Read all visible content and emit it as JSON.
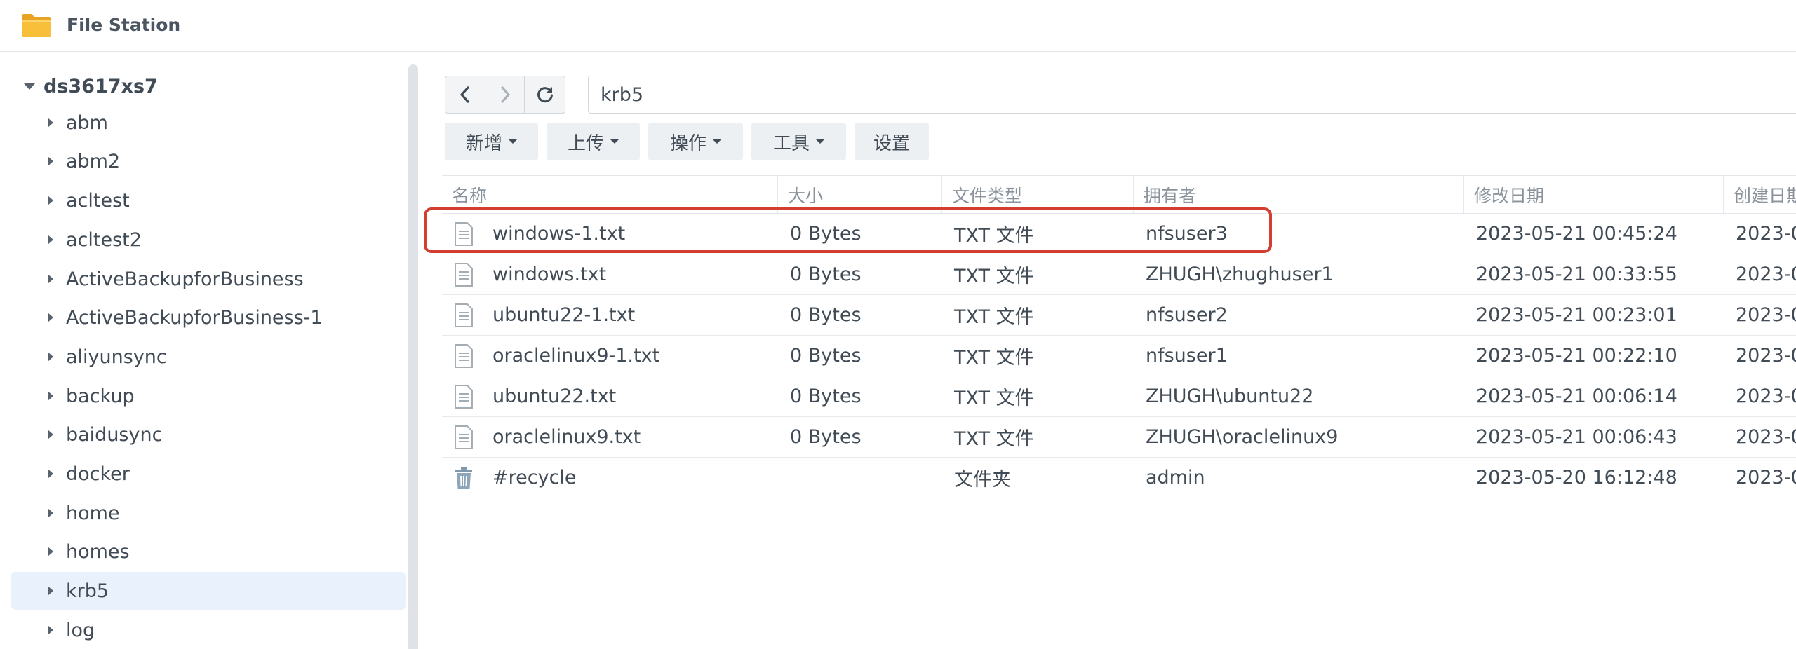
{
  "app": {
    "title": "File Station",
    "icon": "folder-icon"
  },
  "sidebar": {
    "root": "ds3617xs7",
    "items": [
      {
        "label": "abm"
      },
      {
        "label": "abm2"
      },
      {
        "label": "acltest"
      },
      {
        "label": "acltest2"
      },
      {
        "label": "ActiveBackupforBusiness"
      },
      {
        "label": "ActiveBackupforBusiness-1"
      },
      {
        "label": "aliyunsync"
      },
      {
        "label": "backup"
      },
      {
        "label": "baidusync"
      },
      {
        "label": "docker"
      },
      {
        "label": "home"
      },
      {
        "label": "homes"
      },
      {
        "label": "krb5"
      },
      {
        "label": "log"
      }
    ],
    "selected": "krb5"
  },
  "navigation": {
    "back_icon": "chevron-left-icon",
    "forward_icon": "chevron-right-icon",
    "refresh_icon": "refresh-icon",
    "path": "krb5"
  },
  "toolbar": {
    "new_label": "新增",
    "upload_label": "上传",
    "action_label": "操作",
    "tools_label": "工具",
    "settings_label": "设置"
  },
  "table": {
    "columns": [
      "名称",
      "大小",
      "文件类型",
      "拥有者",
      "修改日期",
      "创建日期"
    ],
    "rows": [
      {
        "name": "windows-1.txt",
        "size": "0 Bytes",
        "type": "TXT 文件",
        "owner": "nfsuser3",
        "modified": "2023-05-21 00:45:24",
        "created": "2023-0",
        "icon": "text-file-icon"
      },
      {
        "name": "windows.txt",
        "size": "0 Bytes",
        "type": "TXT 文件",
        "owner": "ZHUGH\\zhughuser1",
        "modified": "2023-05-21 00:33:55",
        "created": "2023-0",
        "icon": "text-file-icon"
      },
      {
        "name": "ubuntu22-1.txt",
        "size": "0 Bytes",
        "type": "TXT 文件",
        "owner": "nfsuser2",
        "modified": "2023-05-21 00:23:01",
        "created": "2023-0",
        "icon": "text-file-icon"
      },
      {
        "name": "oraclelinux9-1.txt",
        "size": "0 Bytes",
        "type": "TXT 文件",
        "owner": "nfsuser1",
        "modified": "2023-05-21 00:22:10",
        "created": "2023-0",
        "icon": "text-file-icon"
      },
      {
        "name": "ubuntu22.txt",
        "size": "0 Bytes",
        "type": "TXT 文件",
        "owner": "ZHUGH\\ubuntu22",
        "modified": "2023-05-21 00:06:14",
        "created": "2023-0",
        "icon": "text-file-icon"
      },
      {
        "name": "oraclelinux9.txt",
        "size": "0 Bytes",
        "type": "TXT 文件",
        "owner": "ZHUGH\\oraclelinux9",
        "modified": "2023-05-21 00:06:43",
        "created": "2023-0",
        "icon": "text-file-icon"
      },
      {
        "name": "#recycle",
        "size": "",
        "type": "文件夹",
        "owner": "admin",
        "modified": "2023-05-20 16:12:48",
        "created": "2023-0",
        "icon": "recycle-bin-icon"
      }
    ]
  },
  "colors": {
    "accent": "#d23f31",
    "selected_bg": "#e8f1fc",
    "folder": "#f5a623"
  }
}
